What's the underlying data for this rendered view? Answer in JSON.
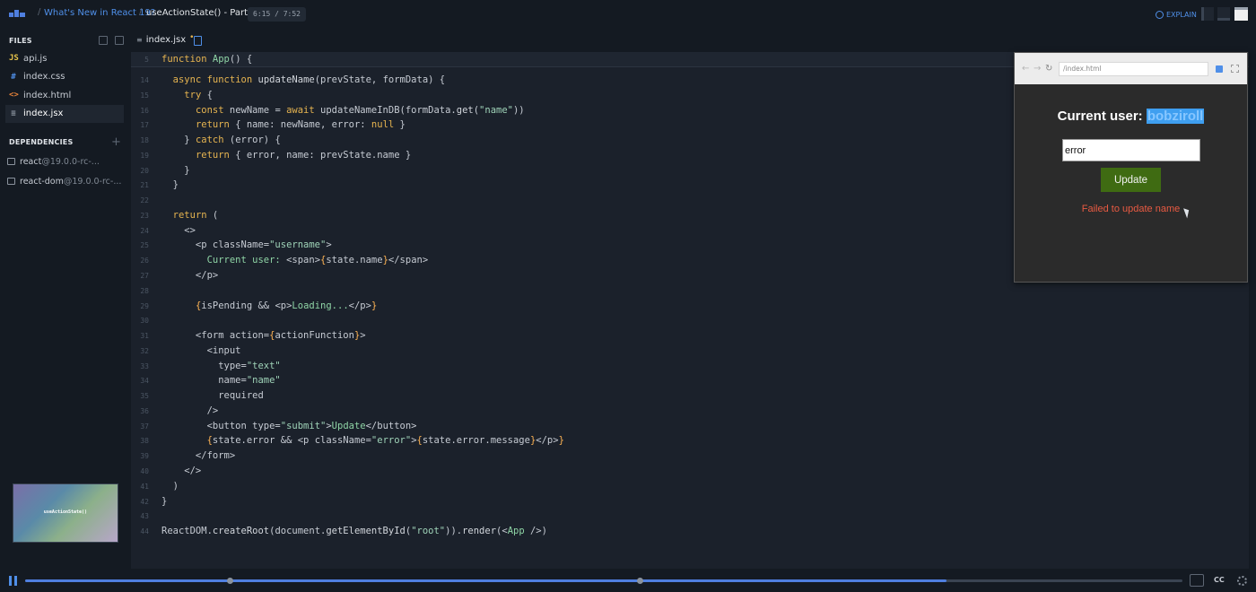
{
  "breadcrumb": {
    "course": "What's New in React 19?",
    "separator": "/",
    "lesson": "useActionState() - Part 3",
    "timecode": "6:15 / 7:52"
  },
  "topbar": {
    "explain_label": "EXPLAIN"
  },
  "sidebar": {
    "files_header": "FILES",
    "files": [
      {
        "icon": "JS",
        "name": "api.js",
        "color": "#e6c34a"
      },
      {
        "icon": "#",
        "name": "index.css",
        "color": "#4f8fe8"
      },
      {
        "icon": "<>",
        "name": "index.html",
        "color": "#e8833a"
      },
      {
        "icon": "≡",
        "name": "index.jsx",
        "color": "#9aa3ae",
        "active": true
      }
    ],
    "dependencies_header": "DEPENDENCIES",
    "dependencies": [
      {
        "name": "react",
        "version": "@19.0.0-rc-..."
      },
      {
        "name": "react-dom",
        "version": "@19.0.0-rc-..."
      }
    ],
    "thumbnail_text": "useActionState()"
  },
  "editor": {
    "tab": {
      "name": "index.jsx",
      "modified": "•"
    },
    "lines": [
      {
        "n": "5",
        "sticky": true,
        "html": "<span class='k'>function</span> <span class='g'>App</span>() {"
      },
      {
        "n": "14",
        "html": "  <span class='k'>async function</span> <span class='f'>updateName</span>(prevState, formData) {"
      },
      {
        "n": "15",
        "html": "    <span class='k'>try</span> {"
      },
      {
        "n": "16",
        "html": "      <span class='k'>const</span> newName = <span class='k'>await</span> updateNameInDB(formData.<span class='f'>get</span>(<span class='s'>\"name\"</span>))"
      },
      {
        "n": "17",
        "html": "      <span class='k'>return</span> { name: newName, error: <span class='k'>null</span> }"
      },
      {
        "n": "18",
        "html": "    } <span class='k'>catch</span> (error) {"
      },
      {
        "n": "19",
        "html": "      <span class='k'>return</span> { error, name: prevState.name }"
      },
      {
        "n": "20",
        "html": "    }"
      },
      {
        "n": "21",
        "html": "  }"
      },
      {
        "n": "22",
        "html": ""
      },
      {
        "n": "23",
        "html": "  <span class='k'>return</span> ("
      },
      {
        "n": "24",
        "html": "    &lt;&gt;"
      },
      {
        "n": "25",
        "html": "      &lt;p className=<span class='s'>\"username\"</span>&gt;"
      },
      {
        "n": "26",
        "html": "        <span class='g'>Current user:</span> &lt;span&gt;<span class='p'>{</span>state.name<span class='p'>}</span>&lt;/span&gt;"
      },
      {
        "n": "27",
        "html": "      &lt;/p&gt;"
      },
      {
        "n": "28",
        "html": ""
      },
      {
        "n": "29",
        "html": "      <span class='p'>{</span>isPending &amp;&amp; &lt;p&gt;<span class='g'>Loading...</span>&lt;/p&gt;<span class='p'>}</span>"
      },
      {
        "n": "30",
        "html": ""
      },
      {
        "n": "31",
        "html": "      &lt;form action=<span class='p'>{</span>actionFunction<span class='p'>}</span>&gt;"
      },
      {
        "n": "32",
        "html": "        &lt;input"
      },
      {
        "n": "33",
        "html": "          type=<span class='s'>\"text\"</span>"
      },
      {
        "n": "34",
        "html": "          name=<span class='s'>\"name\"</span>"
      },
      {
        "n": "35",
        "html": "          required"
      },
      {
        "n": "36",
        "html": "        /&gt;"
      },
      {
        "n": "37",
        "html": "        &lt;button type=<span class='s'>\"submit\"</span>&gt;<span class='g'>Update</span>&lt;/button&gt;"
      },
      {
        "n": "38",
        "html": "        <span class='p'>{</span>state.error &amp;&amp; &lt;p className=<span class='s'>\"error\"</span>&gt;<span class='p'>{</span>state.error.message<span class='p'>}</span>&lt;/p&gt;<span class='p'>}</span>"
      },
      {
        "n": "39",
        "html": "      &lt;/form&gt;"
      },
      {
        "n": "40",
        "html": "    &lt;/&gt;"
      },
      {
        "n": "41",
        "html": "  )"
      },
      {
        "n": "42",
        "html": "}"
      },
      {
        "n": "43",
        "html": ""
      },
      {
        "n": "44",
        "html": "ReactDOM.<span class='f'>createRoot</span>(document.<span class='f'>getElementById</span>(<span class='s'>\"root\"</span>)).<span class='f'>render</span>(&lt;<span class='g'>App</span> /&gt;)"
      }
    ]
  },
  "preview": {
    "url": "/index.html",
    "current_user_label": "Current user:",
    "current_user_name": "bobziroll",
    "input_value": "error",
    "update_label": "Update",
    "error_message": "Failed to update name"
  },
  "player": {
    "progress": 0.796,
    "chapter_marks": [
      0.177,
      0.531
    ],
    "cc_label": "CC"
  },
  "colors": {
    "accent": "#4f8fe8",
    "update_button": "#3f6b12",
    "error_text": "#e85a42",
    "selection": "#3f9ff0"
  }
}
